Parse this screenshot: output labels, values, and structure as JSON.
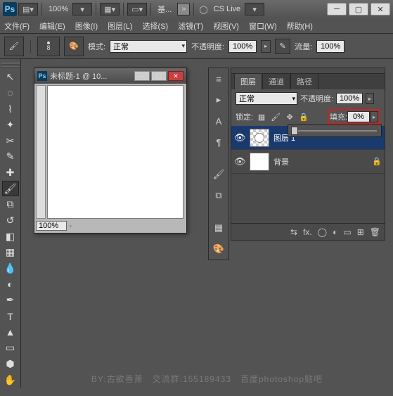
{
  "title": {
    "zoom": "100%",
    "workspace": "基...",
    "cslive": "CS Live"
  },
  "menus": [
    "文件(F)",
    "编辑(E)",
    "图像(I)",
    "图层(L)",
    "选择(S)",
    "滤镜(T)",
    "视图(V)",
    "窗口(W)",
    "帮助(H)"
  ],
  "options": {
    "brush_size": "8",
    "mode_lbl": "模式:",
    "mode_val": "正常",
    "opacity_lbl": "不透明度:",
    "opacity_val": "100%",
    "flow_lbl": "流量:",
    "flow_val": "100%"
  },
  "doc": {
    "title": "未标题-1 @ 10...",
    "zoom": "100%"
  },
  "panel": {
    "tabs": [
      "图层",
      "通道",
      "路径"
    ],
    "blend": "正常",
    "opacity_lbl": "不透明度:",
    "opacity_val": "100%",
    "lock_lbl": "锁定:",
    "fill_lbl": "填充:",
    "fill_val": "0%",
    "layers": [
      {
        "name": "图层 1",
        "selected": true,
        "checker": true,
        "locked": false
      },
      {
        "name": "背景",
        "selected": false,
        "checker": false,
        "locked": true
      }
    ]
  },
  "watermark": "BY:古欲香萧　交流群:155189433　百度photoshop贴吧"
}
